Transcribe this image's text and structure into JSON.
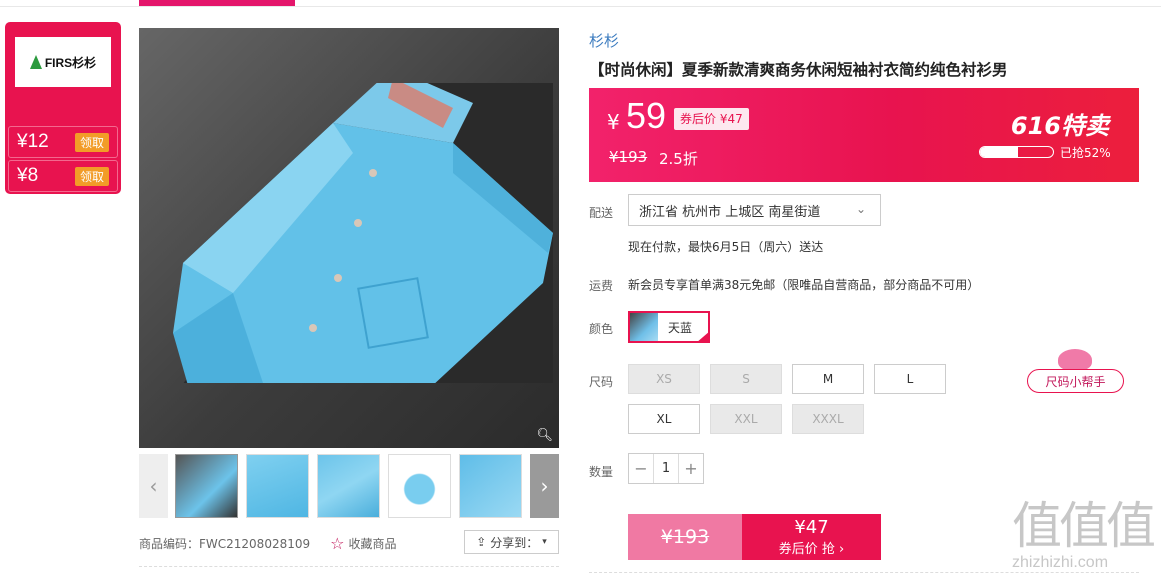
{
  "coupons": [
    {
      "amount": "¥12",
      "action": "领取"
    },
    {
      "amount": "¥8",
      "action": "领取"
    }
  ],
  "brand_logo_text": "FIRS杉杉",
  "product": {
    "brand": "杉杉",
    "title": "【时尚休闲】夏季新款清爽商务休闲短袖衬衣简约纯色衬衫男",
    "sku_code": "商品编码：FWC21208028109",
    "favorite_label": "收藏商品",
    "share_label": "分享到："
  },
  "price": {
    "currency": "¥",
    "current": "59",
    "after_coupon": "券后价 ¥47",
    "original": "¥193",
    "discount": "2.5折",
    "promo": "616特卖",
    "sold_percent": 52,
    "sold_text": "已抢52%"
  },
  "delivery": {
    "label": "配送",
    "address": "浙江省 杭州市 上城区 南星街道",
    "eta": "现在付款，最快6月5日（周六）送达"
  },
  "shipping": {
    "label": "运费",
    "text": "新会员专享首单满38元免邮（限唯品自营商品，部分商品不可用）"
  },
  "color": {
    "label": "颜色",
    "selected": "天蓝"
  },
  "sizes": {
    "label": "尺码",
    "options": [
      {
        "name": "XS",
        "available": false
      },
      {
        "name": "S",
        "available": false
      },
      {
        "name": "M",
        "available": true
      },
      {
        "name": "L",
        "available": true
      },
      {
        "name": "XL",
        "available": true
      },
      {
        "name": "XXL",
        "available": false
      },
      {
        "name": "XXXL",
        "available": false
      }
    ],
    "helper": "尺码小帮手"
  },
  "quantity": {
    "label": "数量",
    "value": "1",
    "minus": "−",
    "plus": "+"
  },
  "buy": {
    "original": "¥193",
    "price": "¥47",
    "action": "券后价 抢 ›"
  },
  "watermark": {
    "logo": "值值值",
    "url": "zhizhizhi.com"
  },
  "colors": {
    "accent": "#e8134f",
    "link": "#3b7bbf"
  }
}
